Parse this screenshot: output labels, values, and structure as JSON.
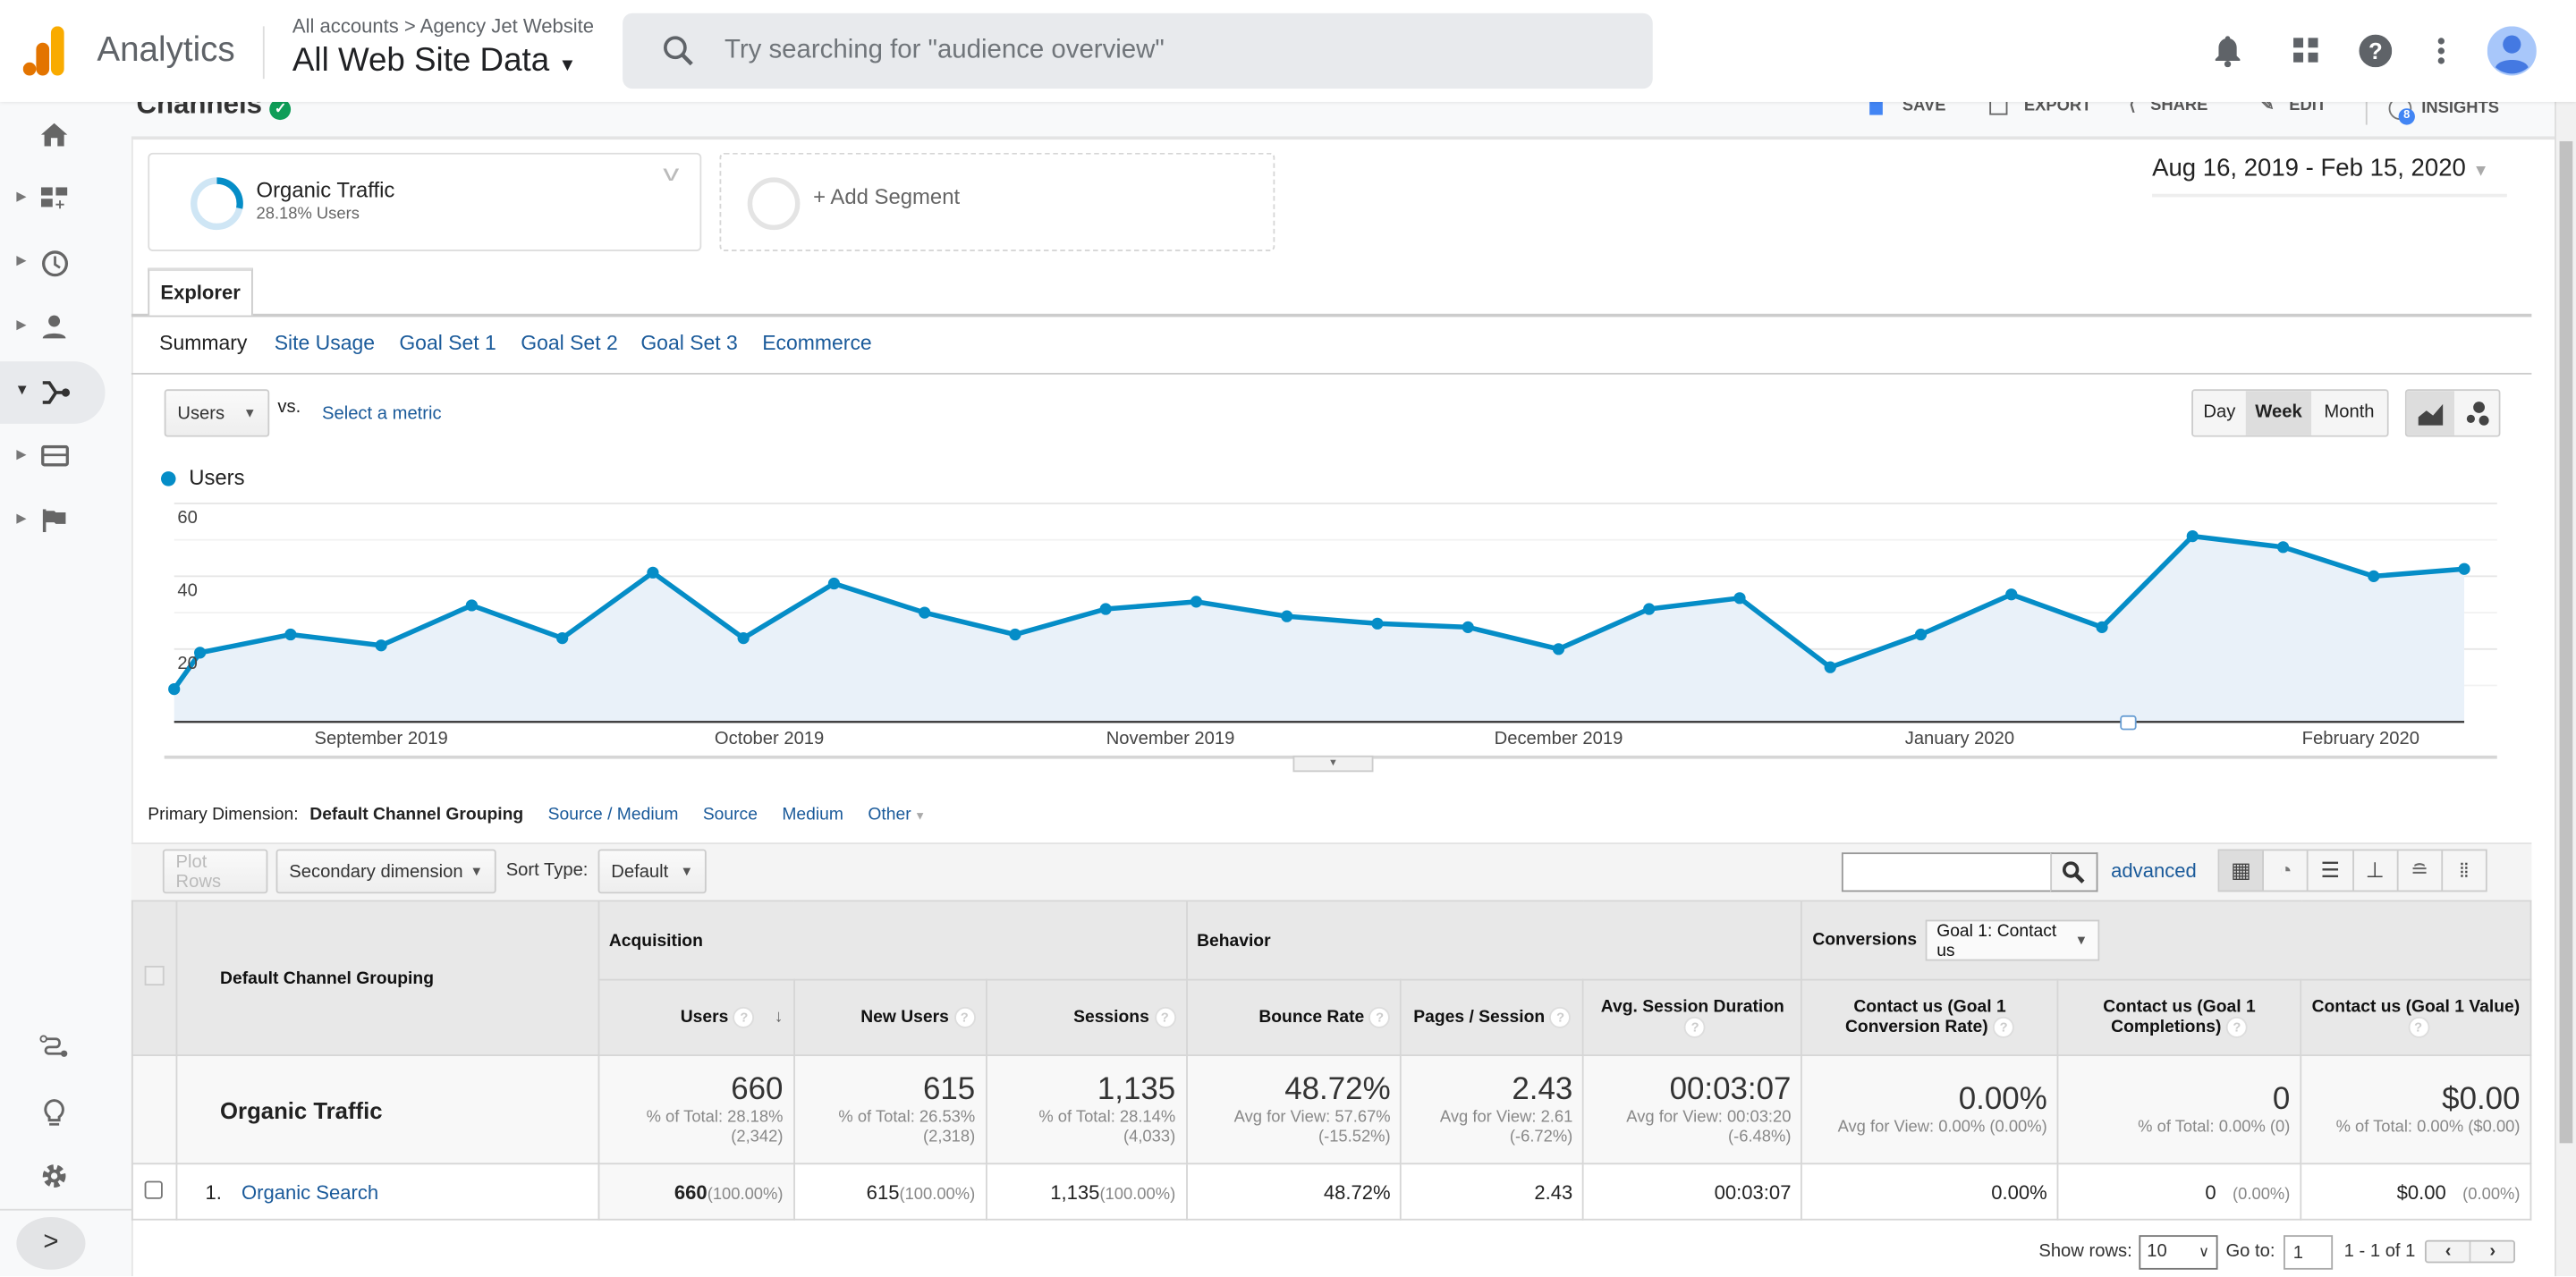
{
  "header": {
    "app_name": "Analytics",
    "breadcrumb": "All accounts > Agency Jet Website",
    "view_name": "All Web Site Data",
    "search_placeholder": "Try searching for \"audience overview\""
  },
  "report": {
    "title": "Channels",
    "actions": {
      "save": "SAVE",
      "export": "EXPORT",
      "share": "SHARE",
      "edit": "EDIT",
      "insights": "INSIGHTS",
      "insights_badge": "8"
    }
  },
  "segments": {
    "active_name": "Organic Traffic",
    "active_detail": "28.18% Users",
    "active_share": 28.18,
    "add_label": "+ Add Segment"
  },
  "date_range": "Aug 16, 2019 - Feb 15, 2020",
  "explorer_tab": "Explorer",
  "subtabs": [
    "Summary",
    "Site Usage",
    "Goal Set 1",
    "Goal Set 2",
    "Goal Set 3",
    "Ecommerce"
  ],
  "chart_controls": {
    "metric": "Users",
    "vs": "vs.",
    "select_metric": "Select a metric",
    "granularity": [
      "Day",
      "Week",
      "Month"
    ],
    "selected_granularity": "Week"
  },
  "chart_data": {
    "type": "area",
    "legend": "Users",
    "series_color": "#058dc7",
    "fill_color": "#e9f1f9",
    "x": [
      "2019-08-16",
      "2019-08-18",
      "2019-08-25",
      "2019-09-01",
      "2019-09-08",
      "2019-09-15",
      "2019-09-22",
      "2019-09-29",
      "2019-10-06",
      "2019-10-13",
      "2019-10-20",
      "2019-10-27",
      "2019-11-03",
      "2019-11-10",
      "2019-11-17",
      "2019-11-24",
      "2019-12-01",
      "2019-12-08",
      "2019-12-15",
      "2019-12-22",
      "2019-12-29",
      "2020-01-05",
      "2020-01-12",
      "2020-01-19",
      "2020-01-26",
      "2020-02-02",
      "2020-02-09"
    ],
    "values": [
      9,
      19,
      24,
      21,
      32,
      23,
      41,
      23,
      38,
      30,
      24,
      31,
      33,
      29,
      27,
      26,
      20,
      31,
      34,
      15,
      24,
      35,
      26,
      51,
      48,
      40,
      42
    ],
    "ylim": [
      0,
      60
    ],
    "yticks": [
      "20",
      "40",
      "60"
    ],
    "xtick_labels": [
      "September 2019",
      "October 2019",
      "November 2019",
      "December 2019",
      "January 2020",
      "February 2020"
    ],
    "xtick_dates": [
      "2019-09-01",
      "2019-10-01",
      "2019-11-01",
      "2019-12-01",
      "2020-01-01",
      "2020-02-01"
    ],
    "grid": true
  },
  "dimension": {
    "label": "Primary Dimension:",
    "selected": "Default Channel Grouping",
    "options": [
      "Source / Medium",
      "Source",
      "Medium",
      "Other"
    ]
  },
  "toolbar": {
    "plot_rows": "Plot Rows",
    "secondary": "Secondary dimension",
    "sort_label": "Sort Type:",
    "sort_value": "Default",
    "advanced": "advanced"
  },
  "table": {
    "dim_header": "Default Channel Grouping",
    "groups": {
      "acquisition": "Acquisition",
      "behavior": "Behavior",
      "conversions": "Conversions",
      "goal_select": "Goal 1: Contact us"
    },
    "columns": [
      "Users",
      "New Users",
      "Sessions",
      "Bounce Rate",
      "Pages / Session",
      "Avg. Session Duration",
      "Contact us (Goal 1 Conversion Rate)",
      "Contact us (Goal 1 Completions)",
      "Contact us (Goal 1 Value)"
    ],
    "total": {
      "label": "Organic Traffic",
      "values": [
        "660",
        "615",
        "1,135",
        "48.72%",
        "2.43",
        "00:03:07",
        "0.00%",
        "0",
        "$0.00"
      ],
      "subs": [
        "% of Total: 28.18% (2,342)",
        "% of Total: 26.53% (2,318)",
        "% of Total: 28.14% (4,033)",
        "Avg for View: 57.67% (-15.52%)",
        "Avg for View: 2.61 (-6.72%)",
        "Avg for View: 00:03:20 (-6.48%)",
        "Avg for View: 0.00% (0.00%)",
        "% of Total: 0.00% (0)",
        "% of Total: 0.00% ($0.00)"
      ]
    },
    "rows": [
      {
        "index": "1.",
        "name": "Organic Search",
        "values": [
          "660",
          "615",
          "1,135",
          "48.72%",
          "2.43",
          "00:03:07",
          "0.00%",
          "0",
          "$0.00"
        ],
        "pcts": [
          "(100.00%)",
          "(100.00%)",
          "(100.00%)",
          "",
          "",
          "",
          "",
          "(0.00%)",
          "(0.00%)"
        ]
      }
    ]
  },
  "pagination": {
    "show_rows_label": "Show rows:",
    "rows": "10",
    "goto_label": "Go to:",
    "goto": "1",
    "range": "1 - 1 of 1"
  }
}
